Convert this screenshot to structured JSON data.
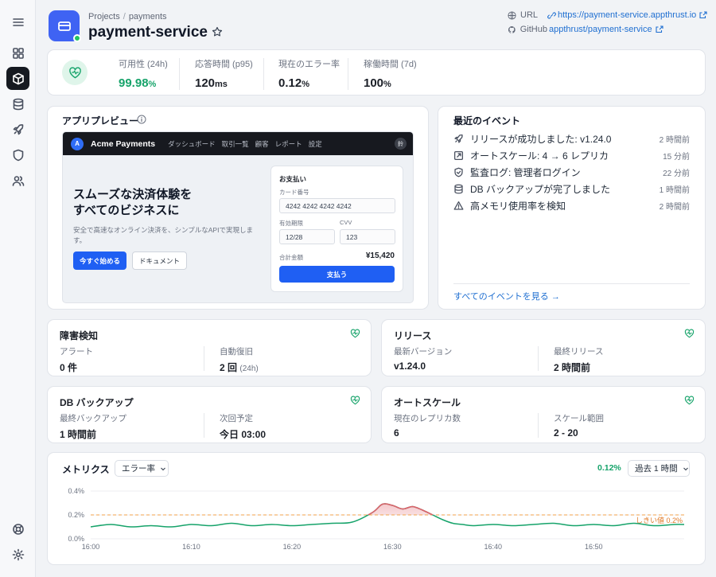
{
  "header": {
    "breadcrumb": [
      "Projects",
      "payments"
    ],
    "breadcrumb_sep": "/",
    "title": "payment-service",
    "url_label": "URL",
    "url": "https://payment-service.appthrust.io",
    "github_label": "GitHub",
    "github": "appthrust/payment-service"
  },
  "stats": [
    {
      "label": "可用性 (24h)",
      "value": "99.98",
      "unit": "%",
      "color": "#16a36a"
    },
    {
      "label": "応答時間 (p95)",
      "value": "120",
      "unit": "ms"
    },
    {
      "label": "現在のエラー率",
      "value": "0.12",
      "unit": "%"
    },
    {
      "label": "稼働時間 (7d)",
      "value": "100",
      "unit": "%"
    }
  ],
  "preview": {
    "title": "アプリプレビュー",
    "logo": "A",
    "brand": "Acme Payments",
    "nav": [
      "ダッシュボード",
      "取引一覧",
      "顧客",
      "レポート",
      "設定"
    ],
    "user": "鈴",
    "headline1": "スムーズな決済体験を",
    "headline2": "すべてのビジネスに",
    "subtext": "安全で高速なオンライン決済を、シンプルなAPIで実現します。",
    "cta_primary": "今すぐ始める",
    "cta_secondary": "ドキュメント",
    "form": {
      "title": "お支払い",
      "card_label": "カード番号",
      "card_value": "4242 4242 4242 4242",
      "exp_label": "有効期限",
      "exp_value": "12/28",
      "cvv_label": "CVV",
      "cvv_value": "123",
      "total_label": "合計金額",
      "total_value": "¥15,420",
      "pay_button": "支払う"
    }
  },
  "events": {
    "title": "最近のイベント",
    "items": [
      {
        "icon": "rocket-icon",
        "text": "リリースが成功しました: v1.24.0",
        "time": "2 時間前"
      },
      {
        "icon": "scale-icon",
        "text": "オートスケール: 4 → 6 レプリカ",
        "time": "15 分前"
      },
      {
        "icon": "shield-icon",
        "text": "監査ログ: 管理者ログイン",
        "time": "22 分前"
      },
      {
        "icon": "database-icon",
        "text": "DB バックアップが完了しました",
        "time": "1 時間前"
      },
      {
        "icon": "warning-icon",
        "text": "高メモリ使用率を検知",
        "time": "2 時間前"
      }
    ],
    "view_all": "すべてのイベントを見る →"
  },
  "cards": {
    "incident": {
      "title": "障害検知",
      "l1": "アラート",
      "v1": "0 件",
      "l2": "自動復旧",
      "v2": "2 回",
      "v2_note": "(24h)"
    },
    "release": {
      "title": "リリース",
      "l1": "最新バージョン",
      "v1": "v1.24.0",
      "l2": "最終リリース",
      "v2": "2 時間前"
    },
    "backup": {
      "title": "DB バックアップ",
      "l1": "最終バックアップ",
      "v1": "1 時間前",
      "l2": "次回予定",
      "v2": "今日 03:00"
    },
    "autoscale": {
      "title": "オートスケール",
      "l1": "現在のレプリカ数",
      "v1": "6",
      "l2": "スケール範囲",
      "v2": "2 - 20"
    }
  },
  "metrics": {
    "title": "メトリクス",
    "metric_select": "エラー率",
    "current": "0.12%",
    "range_select": "過去 1 時間",
    "threshold_label": "しきい値 0.2%"
  },
  "colors": {
    "accent": "#3f63f3",
    "ok": "#16a36a",
    "alert": "#e0606a",
    "threshold": "#f0a24a",
    "link": "#1f6fd1"
  },
  "chart_data": {
    "type": "line",
    "title": "",
    "xlabel": "",
    "ylabel": "",
    "x_ticks": [
      "16:00",
      "16:10",
      "16:20",
      "16:30",
      "16:40",
      "16:50"
    ],
    "y_ticks": [
      "0.0%",
      "0.2%",
      "0.4%"
    ],
    "ylim": [
      0,
      0.4
    ],
    "xlim_minutes": [
      0,
      59
    ],
    "threshold": 0.2,
    "series": [
      {
        "color": "#16a36a",
        "x": [
          0,
          2,
          4,
          6,
          8,
          10,
          12,
          14,
          16,
          18,
          20,
          22,
          24,
          26,
          28,
          29,
          30,
          31,
          32,
          33,
          34,
          35,
          36,
          37,
          38,
          40,
          42,
          44,
          46,
          48,
          50,
          52,
          54,
          56,
          58,
          59
        ],
        "values": [
          0.1,
          0.12,
          0.1,
          0.11,
          0.1,
          0.12,
          0.11,
          0.13,
          0.11,
          0.12,
          0.11,
          0.12,
          0.13,
          0.14,
          0.22,
          0.29,
          0.28,
          0.25,
          0.27,
          0.24,
          0.2,
          0.16,
          0.13,
          0.12,
          0.11,
          0.12,
          0.11,
          0.12,
          0.13,
          0.11,
          0.12,
          0.11,
          0.13,
          0.11,
          0.12,
          0.12
        ]
      }
    ]
  }
}
